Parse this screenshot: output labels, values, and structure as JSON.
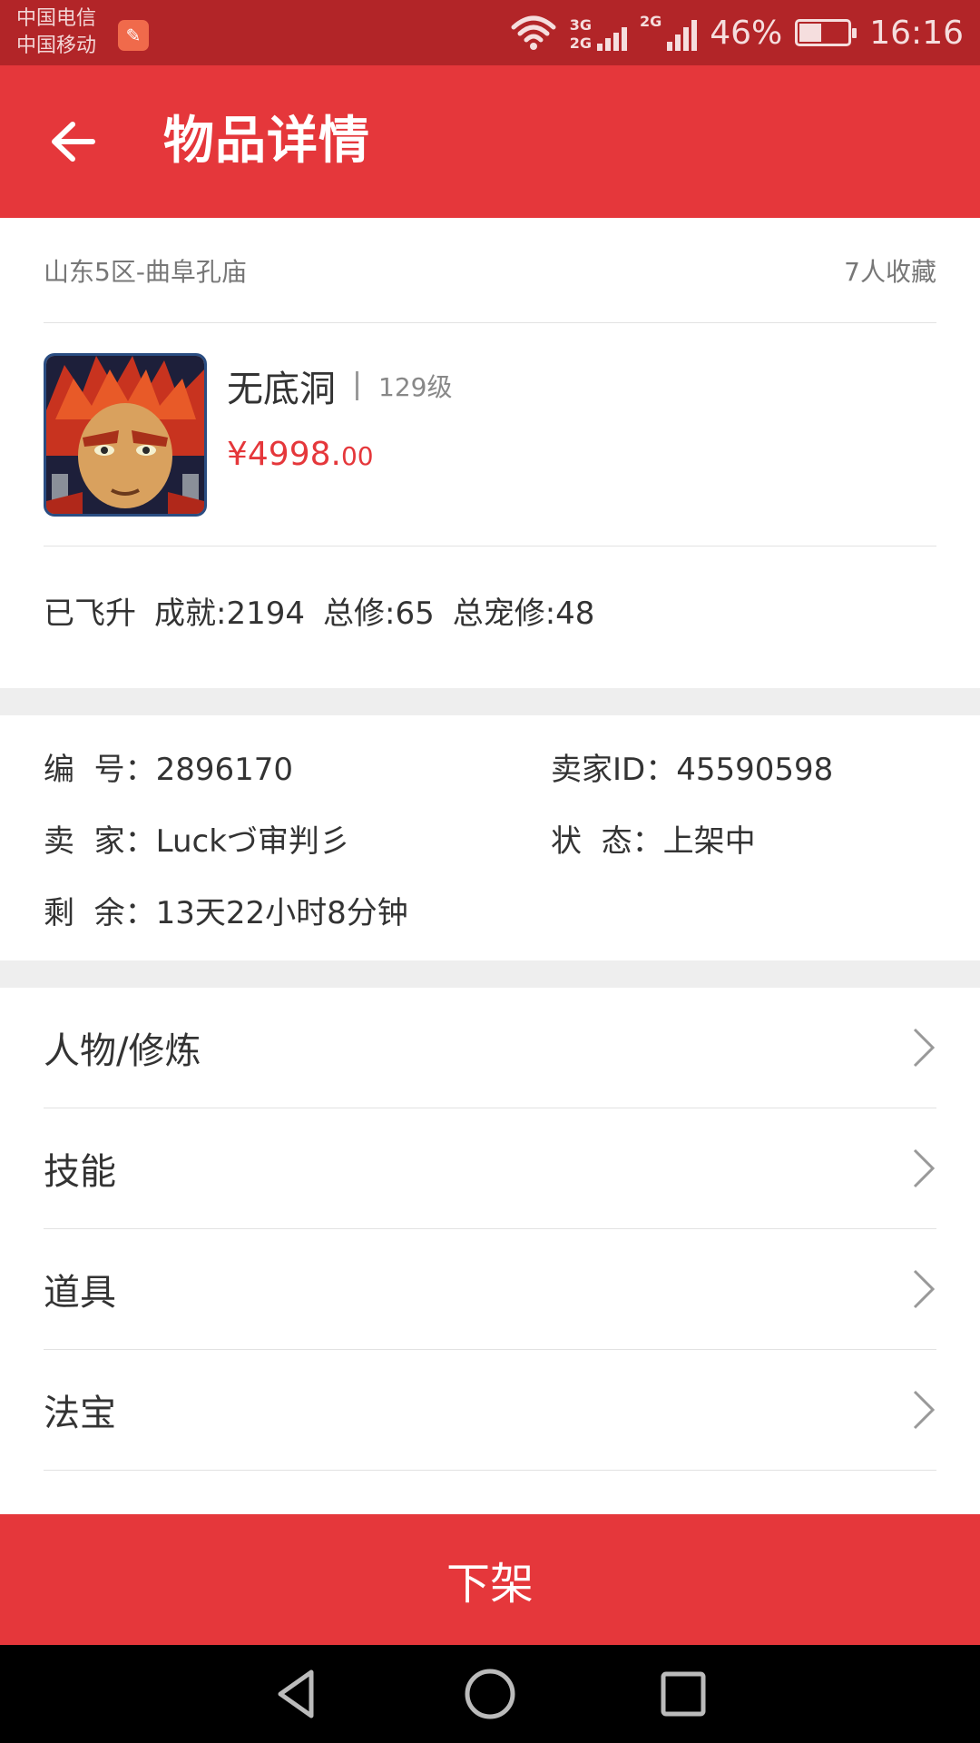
{
  "status_bar": {
    "carrier_1": "中国电信",
    "carrier_2": "中国移动",
    "net_1_top": "3G",
    "net_1_bottom": "2G",
    "net_2": "2G",
    "battery_level": "46%",
    "battery_fraction": 0.46,
    "time": "16:16"
  },
  "app_bar": {
    "title": "物品详情",
    "back_icon": "arrow-left-icon"
  },
  "item": {
    "server": "山东5区-曲阜孔庙",
    "favorites": "7人收藏",
    "name": "无底洞",
    "level": "129级",
    "price_main": "¥4998.",
    "price_cents": "00",
    "stats": [
      "已飞升",
      "成就:2194",
      "总修:65",
      "总宠修:48"
    ]
  },
  "details": {
    "id_label": "编  号：",
    "id_value": "2896170",
    "seller_id_label": "卖家ID：",
    "seller_id_value": "45590598",
    "seller_label": "卖  家：",
    "seller_value": "Luckづ审判彡",
    "status_label": "状  态：",
    "status_value": "上架中",
    "remaining_label": "剩  余：",
    "remaining_value": "13天22小时8分钟"
  },
  "menu": [
    {
      "label": "人物/修炼",
      "icon": "chevron-right-icon"
    },
    {
      "label": "技能",
      "icon": "chevron-right-icon"
    },
    {
      "label": "道具",
      "icon": "chevron-right-icon"
    },
    {
      "label": "法宝",
      "icon": "chevron-right-icon"
    }
  ],
  "bottom_action": {
    "label": "下架"
  },
  "colors": {
    "primary": "#e5373b",
    "status_bar": "#b22528",
    "divider": "#eeeeee"
  }
}
